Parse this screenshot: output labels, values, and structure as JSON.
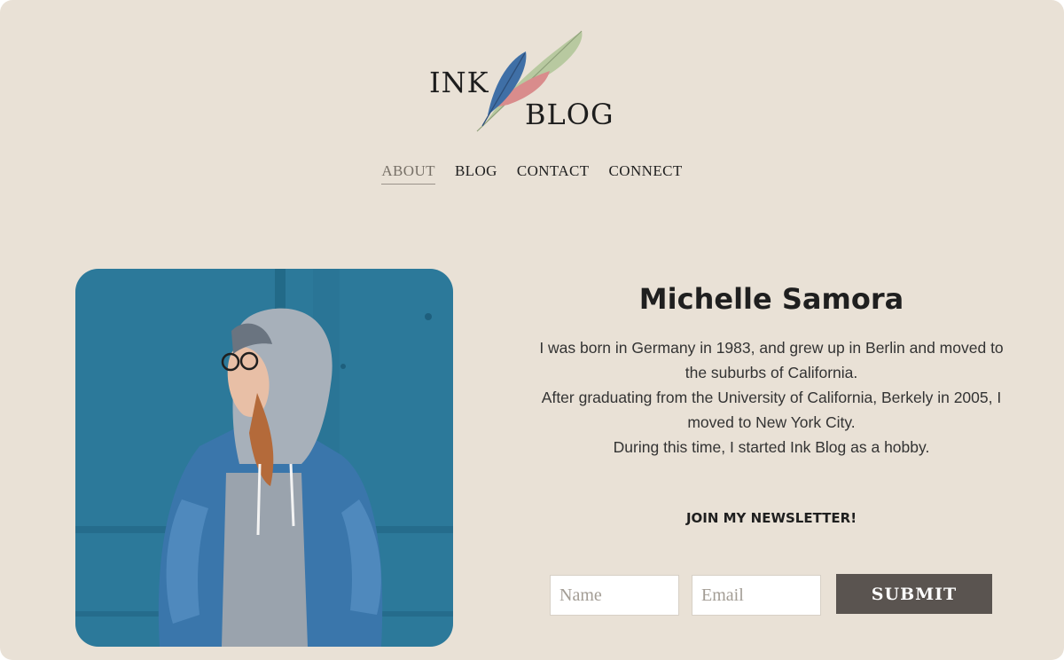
{
  "logo": {
    "line1": "INK",
    "line2": "BLOG",
    "feather_colors": [
      "#3f6fa6",
      "#d98c8c",
      "#b8c9a0"
    ]
  },
  "nav": {
    "items": [
      {
        "label": "ABOUT",
        "active": true
      },
      {
        "label": "BLOG",
        "active": false
      },
      {
        "label": "CONTACT",
        "active": false
      },
      {
        "label": "CONNECT",
        "active": false
      }
    ]
  },
  "profile": {
    "name": "Michelle Samora",
    "bio": [
      "I was born in Germany in 1983, and grew up in Berlin and moved to the suburbs of California.",
      "After graduating from the University of California, Berkely in 2005, I moved to New York City.",
      "During this time, I started Ink Blog as a hobby."
    ],
    "photo_icon": "portrait-photo"
  },
  "newsletter": {
    "title": "JOIN MY NEWSLETTER!",
    "name_placeholder": "Name",
    "email_placeholder": "Email",
    "submit_label": "SUBMIT"
  },
  "colors": {
    "background": "#e9e1d6",
    "button": "#5a5450",
    "photo_wall": "#2f7fa0"
  }
}
